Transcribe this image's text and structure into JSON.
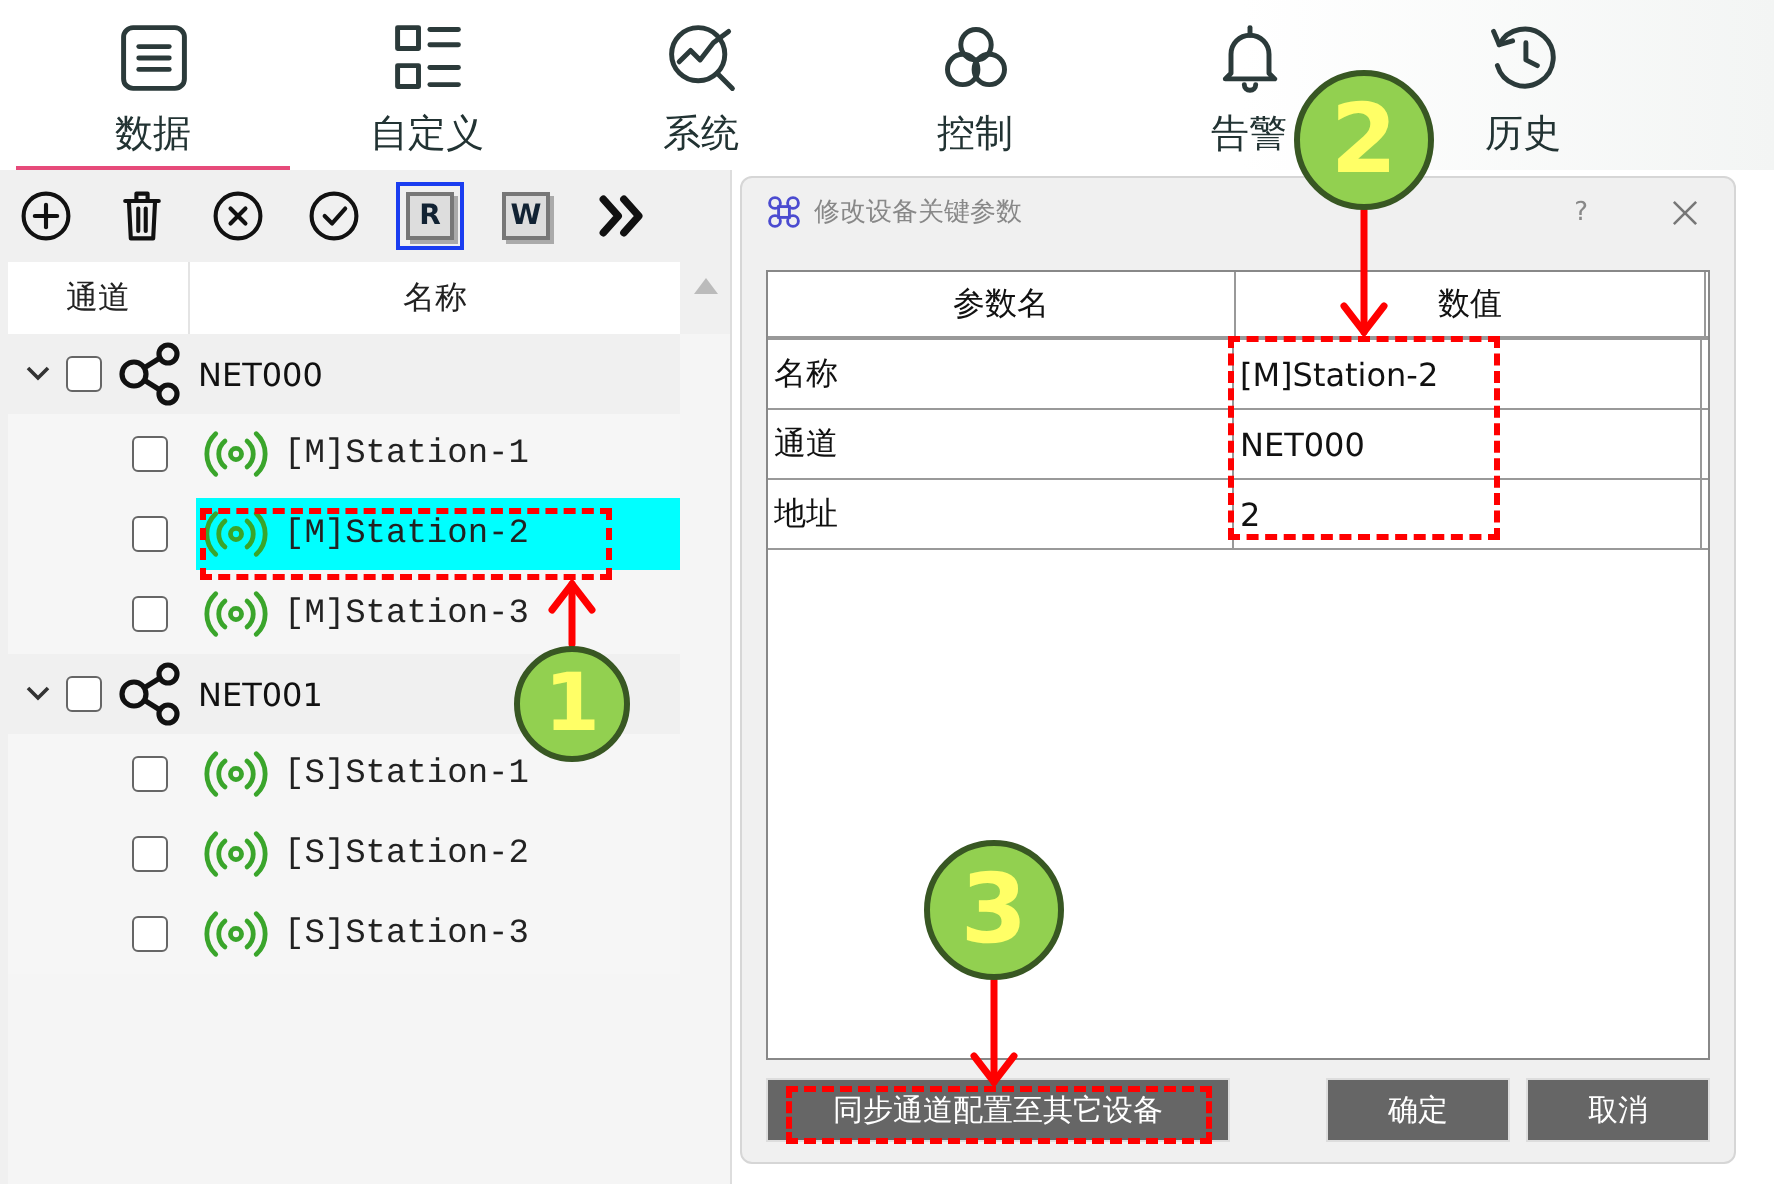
{
  "nav_tabs": [
    {
      "label": "数据",
      "kind": "list",
      "selected": true
    },
    {
      "label": "自定义",
      "kind": "grid",
      "selected": false
    },
    {
      "label": "系统",
      "kind": "chart",
      "selected": false
    },
    {
      "label": "控制",
      "kind": "knot",
      "selected": false
    },
    {
      "label": "告警",
      "kind": "bell",
      "selected": false
    },
    {
      "label": "历史",
      "kind": "history",
      "selected": false
    }
  ],
  "toolbar": [
    {
      "kind": "add"
    },
    {
      "kind": "delete"
    },
    {
      "kind": "cancel"
    },
    {
      "kind": "confirm"
    },
    {
      "kind": "letter",
      "text": "R",
      "selected": true
    },
    {
      "kind": "letter",
      "text": "W",
      "selected": false
    },
    {
      "kind": "more"
    }
  ],
  "tree": {
    "columns": [
      "通道",
      "名称"
    ],
    "groups": [
      {
        "label": "NET000",
        "expanded": true,
        "checked": false,
        "children": [
          {
            "label": "[M]Station-1",
            "checked": false,
            "selected": false
          },
          {
            "label": "[M]Station-2",
            "checked": false,
            "selected": true
          },
          {
            "label": "[M]Station-3",
            "checked": false,
            "selected": false
          }
        ]
      },
      {
        "label": "NET001",
        "expanded": true,
        "checked": false,
        "children": [
          {
            "label": "[S]Station-1",
            "checked": false,
            "selected": false
          },
          {
            "label": "[S]Station-2",
            "checked": false,
            "selected": false
          },
          {
            "label": "[S]Station-3",
            "checked": false,
            "selected": false
          }
        ]
      }
    ]
  },
  "dialog": {
    "title": "修改设备关键参数",
    "help": "?",
    "columns": [
      "参数名",
      "数值"
    ],
    "rows": [
      {
        "name": "名称",
        "value": "[M]Station-2"
      },
      {
        "name": "通道",
        "value": "NET000"
      },
      {
        "name": "地址",
        "value": "2"
      }
    ],
    "buttons": [
      "同步通道配置至其它设备",
      "确定",
      "取消"
    ]
  },
  "callouts": [
    {
      "number": "1"
    },
    {
      "number": "2"
    },
    {
      "number": "3"
    }
  ]
}
